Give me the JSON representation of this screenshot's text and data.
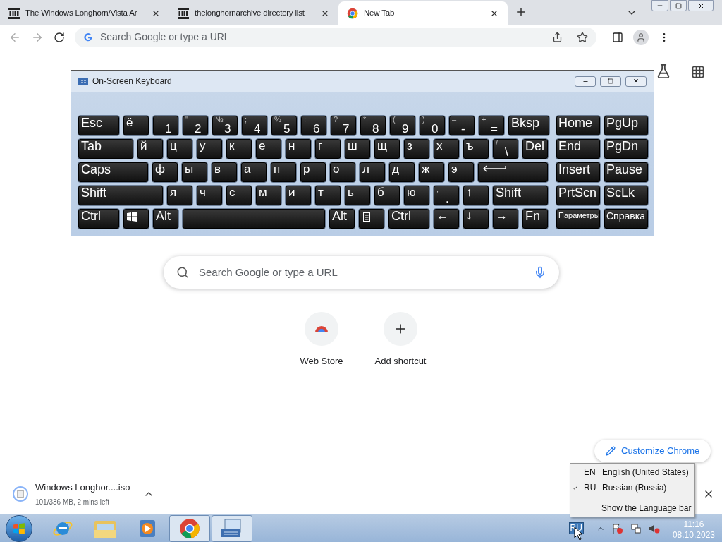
{
  "browser": {
    "tabs": [
      {
        "title": "The Windows Longhorn/Vista Ar",
        "kind": "archive",
        "selected": false
      },
      {
        "title": "thelonghornarchive directory list",
        "kind": "archive",
        "selected": false
      },
      {
        "title": "New Tab",
        "kind": "chrome",
        "selected": true
      }
    ],
    "omnibox": {
      "placeholder": "Search Google or type a URL"
    }
  },
  "new_tab_page": {
    "search": {
      "placeholder": "Search Google or type a URL"
    },
    "shortcuts": [
      {
        "label": "Web Store",
        "kind": "webstore"
      },
      {
        "label": "Add shortcut",
        "kind": "add"
      }
    ],
    "customize_button": "Customize Chrome"
  },
  "keyboard": {
    "title": "On-Screen Keyboard",
    "main_rows": [
      [
        {
          "label": "Esc"
        },
        {
          "label": "ё"
        },
        {
          "label": "1",
          "shift": "!"
        },
        {
          "label": "2",
          "shift": "\""
        },
        {
          "label": "3",
          "shift": "№"
        },
        {
          "label": "4",
          "shift": ";"
        },
        {
          "label": "5",
          "shift": "%"
        },
        {
          "label": "6",
          "shift": ":"
        },
        {
          "label": "7",
          "shift": "?"
        },
        {
          "label": "8",
          "shift": "*"
        },
        {
          "label": "9",
          "shift": "("
        },
        {
          "label": "0",
          "shift": ")"
        },
        {
          "label": "-",
          "shift": "–"
        },
        {
          "label": "=",
          "shift": "+"
        },
        {
          "label": "Bksp"
        }
      ],
      [
        {
          "label": "Tab"
        },
        {
          "label": "й"
        },
        {
          "label": "ц"
        },
        {
          "label": "у"
        },
        {
          "label": "к"
        },
        {
          "label": "е"
        },
        {
          "label": "н"
        },
        {
          "label": "г"
        },
        {
          "label": "ш"
        },
        {
          "label": "щ"
        },
        {
          "label": "з"
        },
        {
          "label": "х"
        },
        {
          "label": "ъ"
        },
        {
          "label": "\\",
          "shift": "/"
        },
        {
          "label": "Del"
        }
      ],
      [
        {
          "label": "Caps"
        },
        {
          "label": "ф"
        },
        {
          "label": "ы"
        },
        {
          "label": "в"
        },
        {
          "label": "а"
        },
        {
          "label": "п"
        },
        {
          "label": "р"
        },
        {
          "label": "о"
        },
        {
          "label": "л"
        },
        {
          "label": "д"
        },
        {
          "label": "ж"
        },
        {
          "label": "э"
        },
        {
          "kind": "enter"
        }
      ],
      [
        {
          "label": "Shift"
        },
        {
          "label": "я"
        },
        {
          "label": "ч"
        },
        {
          "label": "с"
        },
        {
          "label": "м"
        },
        {
          "label": "и"
        },
        {
          "label": "т"
        },
        {
          "label": "ь"
        },
        {
          "label": "б"
        },
        {
          "label": "ю"
        },
        {
          "label": ".",
          "shift": ","
        },
        {
          "label": "↑"
        },
        {
          "label": "Shift"
        }
      ],
      [
        {
          "label": "Ctrl"
        },
        {
          "kind": "windows"
        },
        {
          "label": "Alt"
        },
        {
          "kind": "space"
        },
        {
          "label": "Alt"
        },
        {
          "kind": "menu"
        },
        {
          "label": "Ctrl"
        },
        {
          "label": "←"
        },
        {
          "label": "↓"
        },
        {
          "label": "→"
        },
        {
          "label": "Fn"
        }
      ]
    ],
    "side_rows": [
      [
        "Home",
        "PgUp"
      ],
      [
        "End",
        "PgDn"
      ],
      [
        "Insert",
        "Pause"
      ],
      [
        "PrtScn",
        "ScLk"
      ],
      [
        "Параметры",
        "Справка"
      ]
    ]
  },
  "download": {
    "filename": "Windows Longhor....iso",
    "status": "101/336 MB, 2 mins left"
  },
  "language_menu": {
    "items": [
      {
        "code": "EN",
        "name": "English (United States)",
        "checked": false
      },
      {
        "code": "RU",
        "name": "Russian (Russia)",
        "checked": true
      }
    ],
    "action": "Show the Language bar"
  },
  "taskbar": {
    "apps": [
      {
        "kind": "ie",
        "highlighted": false
      },
      {
        "kind": "explorer",
        "highlighted": false
      },
      {
        "kind": "media",
        "highlighted": false
      },
      {
        "kind": "chrome",
        "highlighted": true
      },
      {
        "kind": "keyboard",
        "highlighted": true
      }
    ],
    "input_indicator": "RU",
    "time": "11:16",
    "date": "08.10.2023"
  }
}
